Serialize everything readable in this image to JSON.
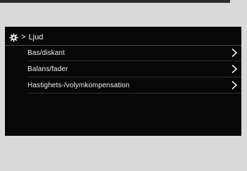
{
  "header": {
    "icon": "gear-icon",
    "separator": ">",
    "title": "Ljud"
  },
  "menu": {
    "items": [
      {
        "label": "Bas/diskant",
        "icon": "chevron-right-icon"
      },
      {
        "label": "Balans/fader",
        "icon": "chevron-right-icon"
      },
      {
        "label": "Hastighets-/volymkompensation",
        "icon": "chevron-right-icon"
      }
    ]
  },
  "colors": {
    "screen_background": "#070707",
    "page_background": "#d9d9d9",
    "text": "#f2f2f2"
  }
}
